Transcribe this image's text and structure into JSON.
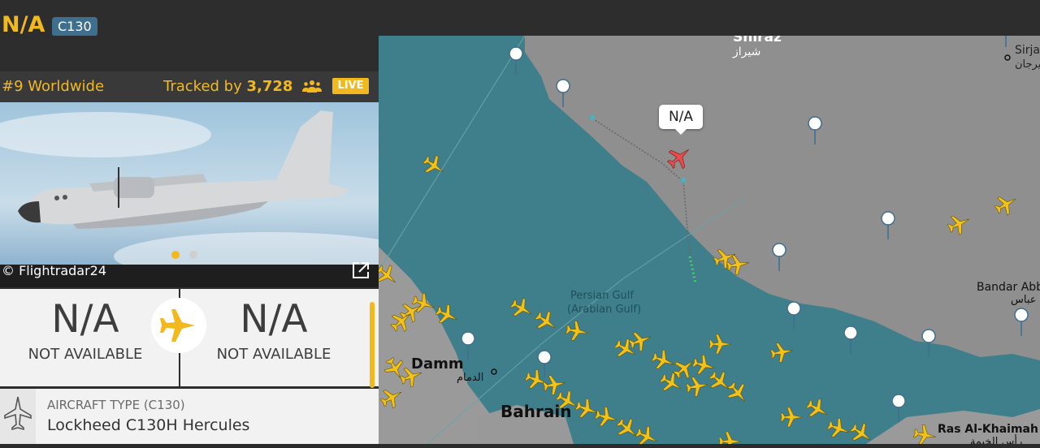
{
  "header": {
    "title": "N/A",
    "badge": "C130"
  },
  "rank": {
    "label": "#9 Worldwide",
    "tracked_prefix": "Tracked by ",
    "tracked_count": "3,728",
    "live": "LIVE"
  },
  "photo": {
    "credit": "© Flightradar24",
    "slide_count": 2,
    "active_slide": 1
  },
  "route": {
    "origin": {
      "code": "N/A",
      "name": "NOT AVAILABLE"
    },
    "destination": {
      "code": "N/A",
      "name": "NOT AVAILABLE"
    }
  },
  "aircraft": {
    "label": "AIRCRAFT TYPE (C130)",
    "name": "Lockheed C130H Hercules"
  },
  "map": {
    "selected_callout": "N/A",
    "labels": {
      "shiraz": "Shiraz",
      "shiraz_ar": "شیراز",
      "sirjan": "Sirja",
      "sirjan_ar": "سیرجان",
      "persian_gulf": "Persian Gulf",
      "arabian_gulf": "(Arabian Gulf)",
      "bandar": "Bandar Abb",
      "bandar_ar": "عباس",
      "dammam": "Damm",
      "dammam_ar": "الدمام",
      "bahrain": "Bahrain",
      "ras": "Ras Al-Khaimah",
      "ras_ar": "رأس الخيمة"
    }
  },
  "colors": {
    "accent": "#f2b91f",
    "badge": "#3f6f8e",
    "sea": "#3f7f8b",
    "land": "#8f8f8f",
    "selected_plane": "#e84c4c"
  }
}
